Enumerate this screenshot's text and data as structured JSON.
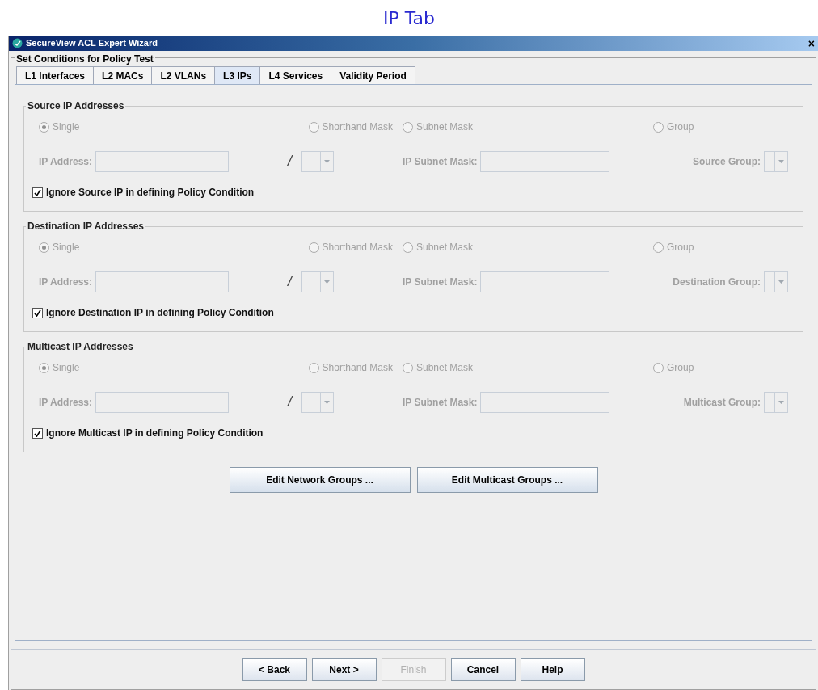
{
  "caption": "IP Tab",
  "window": {
    "title": "SecureView ACL Expert Wizard",
    "close": "×"
  },
  "group_title": "Set Conditions for Policy Test",
  "tabs": [
    {
      "label": "L1 Interfaces",
      "selected": false
    },
    {
      "label": "L2 MACs",
      "selected": false
    },
    {
      "label": "L2 VLANs",
      "selected": false
    },
    {
      "label": "L3 IPs",
      "selected": true
    },
    {
      "label": "L4 Services",
      "selected": false
    },
    {
      "label": "Validity Period",
      "selected": false
    }
  ],
  "sections": [
    {
      "title": "Source  IP Addresses",
      "disabled": true,
      "radios": [
        {
          "label": "Single",
          "selected": true
        },
        {
          "label": "Shorthand Mask",
          "selected": false
        },
        {
          "label": "Subnet Mask",
          "selected": false
        },
        {
          "label": "Group",
          "selected": false
        }
      ],
      "ip_label": "IP Address:",
      "slash": "/",
      "mask_label": "IP Subnet Mask:",
      "group_label": "Source Group:",
      "ignore": {
        "label": "Ignore Source IP in defining Policy Condition",
        "checked": true
      }
    },
    {
      "title": "Destination  IP Addresses",
      "disabled": true,
      "radios": [
        {
          "label": "Single",
          "selected": true
        },
        {
          "label": "Shorthand Mask",
          "selected": false
        },
        {
          "label": "Subnet Mask",
          "selected": false
        },
        {
          "label": "Group",
          "selected": false
        }
      ],
      "ip_label": "IP Address:",
      "slash": "/",
      "mask_label": "IP Subnet Mask:",
      "group_label": "Destination Group:",
      "ignore": {
        "label": "Ignore Destination IP in defining Policy Condition",
        "checked": true
      }
    },
    {
      "title": "Multicast  IP Addresses",
      "disabled": true,
      "radios": [
        {
          "label": "Single",
          "selected": true
        },
        {
          "label": "Shorthand Mask",
          "selected": false
        },
        {
          "label": "Subnet Mask",
          "selected": false
        },
        {
          "label": "Group",
          "selected": false
        }
      ],
      "ip_label": "IP Address:",
      "slash": "/",
      "mask_label": "IP Subnet Mask:",
      "group_label": "Multicast Group:",
      "ignore": {
        "label": "Ignore Multicast IP in defining Policy Condition",
        "checked": true
      }
    }
  ],
  "edit_buttons": [
    "Edit Network Groups ...",
    "Edit Multicast Groups ..."
  ],
  "nav_buttons": [
    {
      "label": "< Back",
      "disabled": false
    },
    {
      "label": "Next >",
      "disabled": false
    },
    {
      "label": "Finish",
      "disabled": true
    },
    {
      "label": "Cancel",
      "disabled": false
    },
    {
      "label": "Help",
      "disabled": false
    }
  ]
}
